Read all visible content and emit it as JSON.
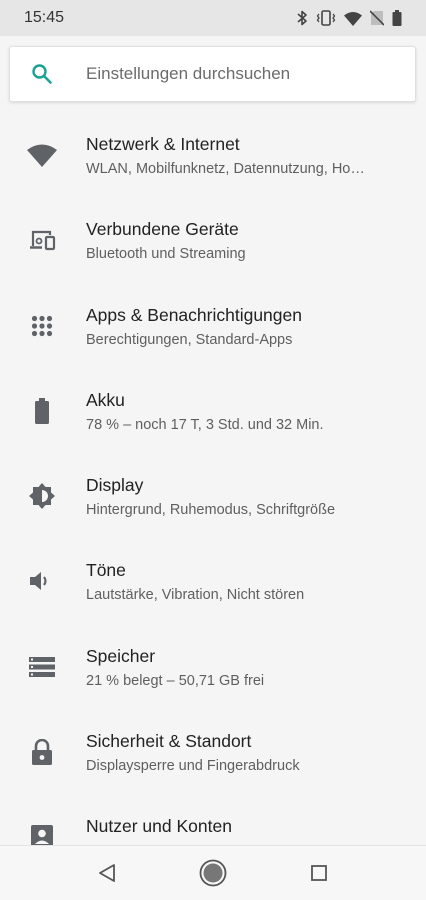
{
  "status_bar": {
    "time": "15:45",
    "icons": [
      "bluetooth-icon",
      "vibrate-icon",
      "wifi-icon",
      "no-sim-icon",
      "battery-icon"
    ]
  },
  "search": {
    "placeholder": "Einstellungen durchsuchen",
    "icon": "search-icon",
    "accent_color": "#1aa394"
  },
  "settings": [
    {
      "icon": "wifi-icon",
      "title": "Netzwerk & Internet",
      "summary": "WLAN, Mobilfunknetz, Datennutzung, Ho…"
    },
    {
      "icon": "connected-devices-icon",
      "title": "Verbundene Geräte",
      "summary": "Bluetooth und Streaming"
    },
    {
      "icon": "apps-icon",
      "title": "Apps & Benachrichtigungen",
      "summary": "Berechtigungen, Standard-Apps"
    },
    {
      "icon": "battery-icon",
      "title": "Akku",
      "summary": "78 % – noch 17 T, 3 Std. und 32 Min."
    },
    {
      "icon": "brightness-icon",
      "title": "Display",
      "summary": "Hintergrund, Ruhemodus, Schriftgröße"
    },
    {
      "icon": "volume-icon",
      "title": "Töne",
      "summary": "Lautstärke, Vibration, Nicht stören"
    },
    {
      "icon": "storage-icon",
      "title": "Speicher",
      "summary": "21 % belegt – 50,71 GB frei"
    },
    {
      "icon": "lock-icon",
      "title": "Sicherheit & Standort",
      "summary": "Displaysperre und Fingerabdruck"
    },
    {
      "icon": "account-icon",
      "title": "Nutzer und Konten",
      "summary": ""
    }
  ],
  "nav_bar": {
    "buttons": [
      "back-icon",
      "home-icon",
      "recents-icon"
    ]
  },
  "colors": {
    "icon": "#5f6368",
    "background": "#f5f5f5",
    "status_bar": "#e6e6e6"
  }
}
